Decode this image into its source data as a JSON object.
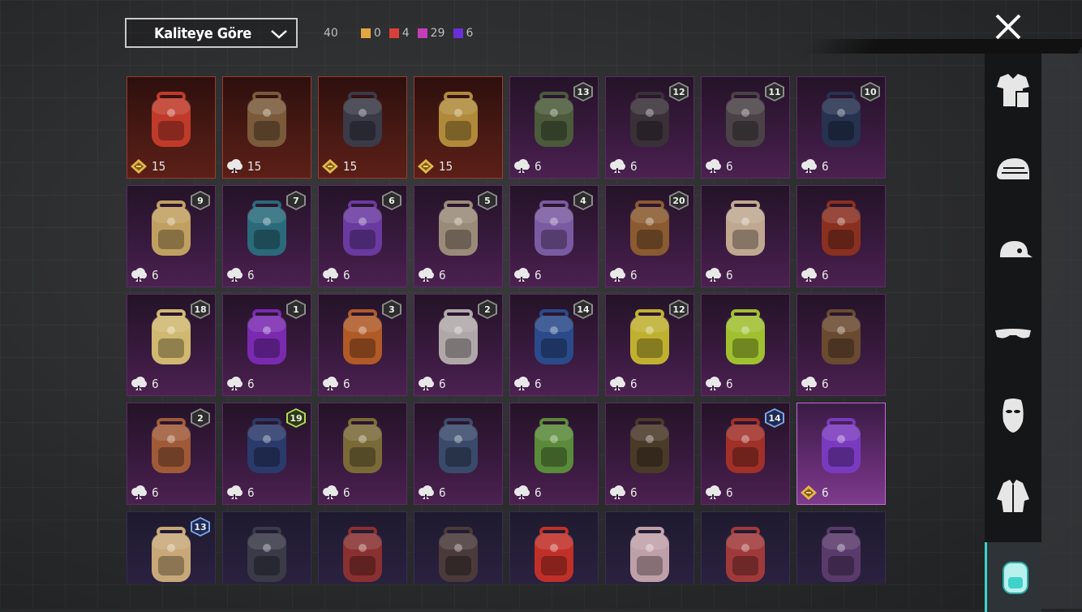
{
  "sort": {
    "label": "Kaliteye Göre"
  },
  "counts": {
    "total": "40",
    "by_quality": [
      {
        "color": "#e3a640",
        "value": "0"
      },
      {
        "color": "#d9403b",
        "value": "4"
      },
      {
        "color": "#c43db8",
        "value": "29"
      },
      {
        "color": "#6a2fd6",
        "value": "6"
      }
    ]
  },
  "items": [
    {
      "rarity": "legend",
      "level": "",
      "price": "15",
      "price_icon": "gold-coupon-icon",
      "art_color": "#c03a2a"
    },
    {
      "rarity": "legend",
      "level": "",
      "price": "15",
      "price_icon": "cloud-coin-icon",
      "art_color": "#7a5a3a"
    },
    {
      "rarity": "legend",
      "level": "",
      "price": "15",
      "price_icon": "gold-coupon-icon",
      "art_color": "#3a3a48"
    },
    {
      "rarity": "legend",
      "level": "",
      "price": "15",
      "price_icon": "gold-coupon-icon",
      "art_color": "#b08a3a"
    },
    {
      "rarity": "epic",
      "level": "13",
      "price": "6",
      "price_icon": "cloud-coin-icon",
      "art_color": "#4a5a3a"
    },
    {
      "rarity": "epic",
      "level": "12",
      "price": "6",
      "price_icon": "cloud-coin-icon",
      "art_color": "#3a3038"
    },
    {
      "rarity": "epic",
      "level": "11",
      "price": "6",
      "price_icon": "cloud-coin-icon",
      "art_color": "#4a4246"
    },
    {
      "rarity": "epic",
      "level": "10",
      "price": "6",
      "price_icon": "cloud-coin-icon",
      "art_color": "#26324f"
    },
    {
      "rarity": "epic",
      "level": "9",
      "price": "6",
      "price_icon": "cloud-coin-icon",
      "art_color": "#c0a060"
    },
    {
      "rarity": "epic",
      "level": "7",
      "price": "6",
      "price_icon": "cloud-coin-icon",
      "art_color": "#2a6a7a"
    },
    {
      "rarity": "epic",
      "level": "6",
      "price": "6",
      "price_icon": "cloud-coin-icon",
      "art_color": "#6a3aa0"
    },
    {
      "rarity": "epic",
      "level": "5",
      "price": "6",
      "price_icon": "cloud-coin-icon",
      "art_color": "#9a8a78"
    },
    {
      "rarity": "epic",
      "level": "4",
      "price": "6",
      "price_icon": "cloud-coin-icon",
      "art_color": "#7a5aa0"
    },
    {
      "rarity": "epic",
      "level": "20",
      "price": "6",
      "price_icon": "cloud-coin-icon",
      "art_color": "#8a5a30"
    },
    {
      "rarity": "epic",
      "level": "",
      "price": "6",
      "price_icon": "cloud-coin-icon",
      "art_color": "#c0a890"
    },
    {
      "rarity": "epic",
      "level": "",
      "price": "6",
      "price_icon": "cloud-coin-icon",
      "art_color": "#8a3020"
    },
    {
      "rarity": "epic",
      "level": "18",
      "price": "6",
      "price_icon": "cloud-coin-icon",
      "art_color": "#d0b870"
    },
    {
      "rarity": "epic",
      "level": "1",
      "price": "6",
      "price_icon": "cloud-coin-icon",
      "art_color": "#7a2ab0"
    },
    {
      "rarity": "epic",
      "level": "3",
      "price": "6",
      "price_icon": "cloud-coin-icon",
      "art_color": "#b05a28"
    },
    {
      "rarity": "epic",
      "level": "2",
      "price": "6",
      "price_icon": "cloud-coin-icon",
      "art_color": "#b0a8a8"
    },
    {
      "rarity": "epic",
      "level": "14",
      "price": "6",
      "price_icon": "cloud-coin-icon",
      "art_color": "#2a4a8a"
    },
    {
      "rarity": "epic",
      "level": "12",
      "price": "6",
      "price_icon": "cloud-coin-icon",
      "art_color": "#c0b030"
    },
    {
      "rarity": "epic",
      "level": "",
      "price": "6",
      "price_icon": "cloud-coin-icon",
      "art_color": "#a0c030"
    },
    {
      "rarity": "epic",
      "level": "",
      "price": "6",
      "price_icon": "cloud-coin-icon",
      "art_color": "#6a4a30"
    },
    {
      "rarity": "epic",
      "level": "2",
      "price": "6",
      "price_icon": "cloud-coin-icon",
      "art_color": "#a05a38"
    },
    {
      "rarity": "epic",
      "level": "19",
      "badge_style": "green",
      "price": "6",
      "price_icon": "cloud-coin-icon",
      "art_color": "#2a3a6a"
    },
    {
      "rarity": "epic",
      "level": "",
      "price": "6",
      "price_icon": "cloud-coin-icon",
      "art_color": "#7a6a38"
    },
    {
      "rarity": "epic",
      "level": "",
      "price": "6",
      "price_icon": "cloud-coin-icon",
      "art_color": "#3a4a6a"
    },
    {
      "rarity": "epic",
      "level": "",
      "price": "6",
      "price_icon": "cloud-coin-icon",
      "art_color": "#5a8a3a"
    },
    {
      "rarity": "epic",
      "level": "",
      "price": "6",
      "price_icon": "cloud-coin-icon",
      "art_color": "#4a3a28"
    },
    {
      "rarity": "epic",
      "level": "14",
      "badge_style": "blue",
      "price": "6",
      "price_icon": "cloud-coin-icon",
      "art_color": "#a03028"
    },
    {
      "rarity": "selected",
      "level": "",
      "price": "6",
      "price_icon": "gold-coupon-icon",
      "art_color": "#7a3ac0"
    },
    {
      "rarity": "partial",
      "level": "13",
      "badge_style": "blue",
      "price": "",
      "price_icon": "",
      "art_color": "#c8a878"
    },
    {
      "rarity": "partial",
      "level": "",
      "price": "",
      "price_icon": "",
      "art_color": "#3a3a48"
    },
    {
      "rarity": "partial",
      "level": "",
      "price": "",
      "price_icon": "",
      "art_color": "#8a3030"
    },
    {
      "rarity": "partial",
      "level": "",
      "price": "",
      "price_icon": "",
      "art_color": "#4a3a3a"
    },
    {
      "rarity": "partial",
      "level": "",
      "price": "",
      "price_icon": "",
      "art_color": "#c03028"
    },
    {
      "rarity": "partial",
      "level": "",
      "price": "",
      "price_icon": "",
      "art_color": "#c0a0a8"
    },
    {
      "rarity": "partial",
      "level": "",
      "price": "",
      "price_icon": "",
      "art_color": "#a03a3a"
    },
    {
      "rarity": "partial",
      "level": "",
      "price": "",
      "price_icon": "",
      "art_color": "#5a3a6a"
    }
  ],
  "side_tabs": [
    {
      "name": "outfit-tab",
      "icon": "outfit-icon",
      "active": false
    },
    {
      "name": "helmet-tab",
      "icon": "helmet-icon",
      "active": false
    },
    {
      "name": "cap-tab",
      "icon": "cap-icon",
      "active": false
    },
    {
      "name": "glasses-tab",
      "icon": "glasses-icon",
      "active": false
    },
    {
      "name": "mask-tab",
      "icon": "mask-icon",
      "active": false
    },
    {
      "name": "jacket-tab",
      "icon": "jacket-icon",
      "active": false
    },
    {
      "name": "backpack-tab",
      "icon": "backpack-icon",
      "active": true
    }
  ]
}
